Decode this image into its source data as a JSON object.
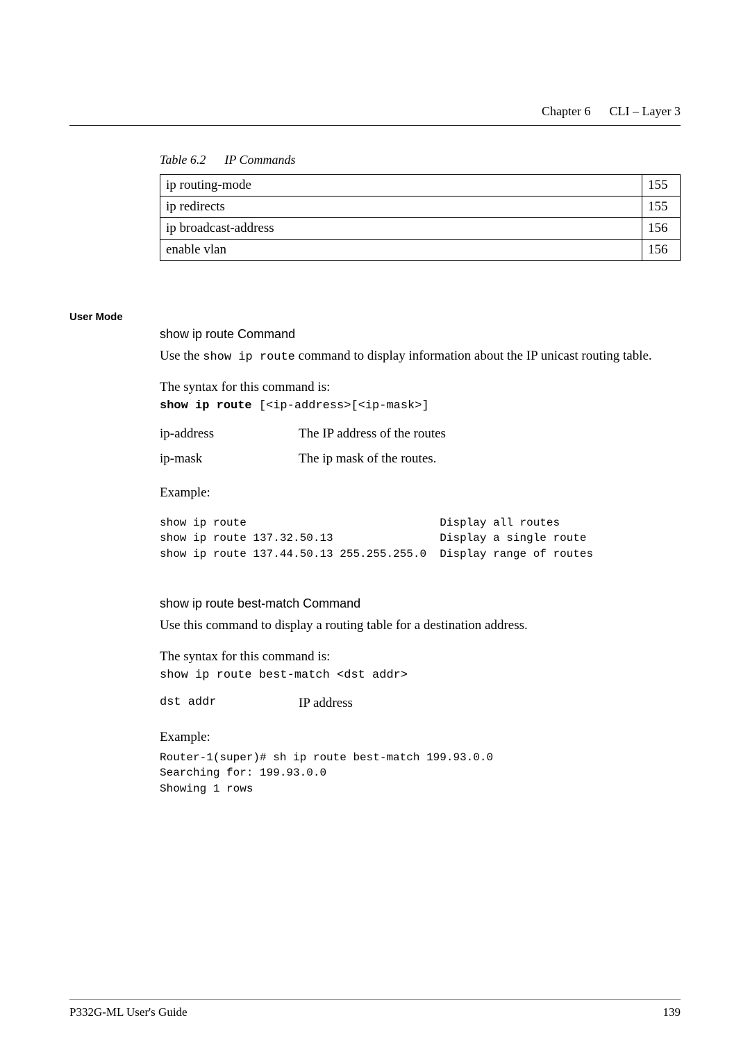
{
  "header": {
    "chapter": "Chapter 6",
    "title": "CLI – Layer 3"
  },
  "table": {
    "caption_prefix": "Table 6.2",
    "caption_title": "IP Commands",
    "rows": [
      {
        "command": "ip routing-mode",
        "page": "155"
      },
      {
        "command": "ip redirects",
        "page": "155"
      },
      {
        "command": "ip broadcast-address",
        "page": "156"
      },
      {
        "command": "enable vlan",
        "page": "156"
      }
    ]
  },
  "section_label": "User Mode",
  "cmd1": {
    "heading": "show ip route Command",
    "desc_pre": "Use the ",
    "desc_cmd": "show ip route",
    "desc_post": " command to display information about the IP unicast routing table.",
    "syntax_intro": "The syntax for this command is:",
    "syntax_bold": "show ip route",
    "syntax_rest": " [<ip-address>[<ip-mask>]",
    "params": [
      {
        "name": "ip-address",
        "desc": "The IP address of the routes"
      },
      {
        "name": "ip-mask",
        "desc": "The ip mask of the routes."
      }
    ],
    "example_label": "Example:",
    "example_text": "show ip route                             Display all routes\nshow ip route 137.32.50.13                Display a single route\nshow ip route 137.44.50.13 255.255.255.0  Display range of routes"
  },
  "cmd2": {
    "heading": "show ip route best-match Command",
    "desc": "Use this command to display a routing table for a destination address.",
    "syntax_intro": "The syntax for this command is:",
    "syntax_line": "show ip route best-match <dst addr>",
    "param_name": "dst addr",
    "param_desc": "IP address",
    "example_label": "Example:",
    "example_text": "Router-1(super)# sh ip route best-match 199.93.0.0\nSearching for: 199.93.0.0\nShowing 1 rows"
  },
  "footer": {
    "left": "P332G-ML User's Guide",
    "right": "139"
  }
}
